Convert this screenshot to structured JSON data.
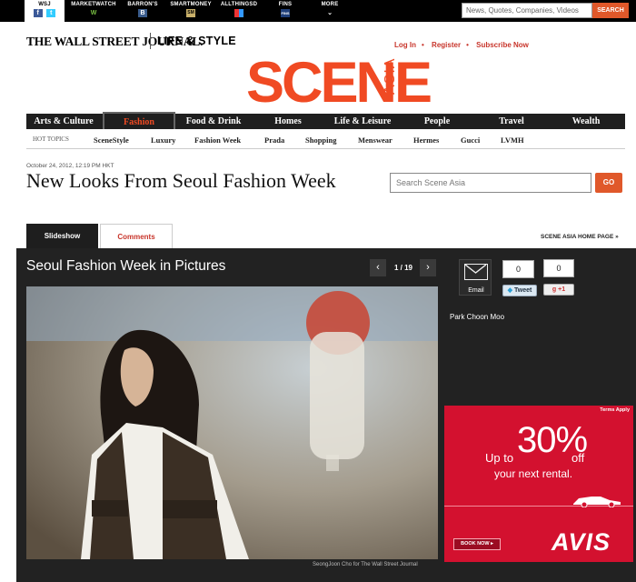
{
  "network": {
    "items": [
      {
        "label": "WSJ",
        "icon": "facebook-twitter-icons"
      },
      {
        "label": "MARKETWATCH",
        "icon": "W"
      },
      {
        "label": "BARRON'S",
        "icon": "B"
      },
      {
        "label": "SMARTMONEY",
        "icon": "SM"
      },
      {
        "label": "ALLTHINGSD",
        "icon": "grid"
      },
      {
        "label": "FINS",
        "icon": "FINS"
      },
      {
        "label": "MORE",
        "icon": "chevron-down"
      }
    ],
    "search_placeholder": "News, Quotes, Companies, Videos",
    "search_button": "SEARCH"
  },
  "masthead": {
    "wsj_logo": "THE WALL STREET JOURNAL.",
    "section": "LIFE & STYLE",
    "links": [
      "Log In",
      "Register",
      "Subscribe Now"
    ],
    "scene_logo": "SCENE",
    "scene_sub": "ASIA",
    "accent": "#f04a23"
  },
  "nav": {
    "items": [
      "Arts & Culture",
      "Fashion",
      "Food & Drink",
      "Homes",
      "Life & Leisure",
      "People",
      "Travel",
      "Wealth"
    ],
    "active": "Fashion"
  },
  "hot_topics": {
    "label": "HOT TOPICS",
    "items": [
      "SceneStyle",
      "Luxury",
      "Fashion Week",
      "Prada",
      "Shopping",
      "Menswear",
      "Hermes",
      "Gucci",
      "LVMH"
    ]
  },
  "article": {
    "dateline": "October 24, 2012, 12:19 PM HKT",
    "headline": "New Looks From Seoul Fashion Week",
    "search_placeholder": "Search Scene Asia",
    "go_label": "GO"
  },
  "tabs": {
    "slideshow": "Slideshow",
    "comments": "Comments",
    "home_link": "SCENE ASIA HOME PAGE »"
  },
  "slideshow": {
    "title": "Seoul Fashion Week in Pictures",
    "pager": "1 / 19",
    "prev": "‹",
    "next": "›",
    "photo_credit": "SeongJoon Cho for The Wall Street Journal",
    "caption": "Park Choon Moo"
  },
  "share": {
    "email_label": "Email",
    "tweet_count": "0",
    "tweet_label": "Tweet",
    "plus_count": "0",
    "plus_label": "+1"
  },
  "ad": {
    "terms": "Terms Apply",
    "up_to": "Up to",
    "percent": "30%",
    "off": "off",
    "line2": "your next rental.",
    "cta": "BOOK NOW ▸",
    "brand": "AVIS",
    "color": "#d3112f"
  }
}
